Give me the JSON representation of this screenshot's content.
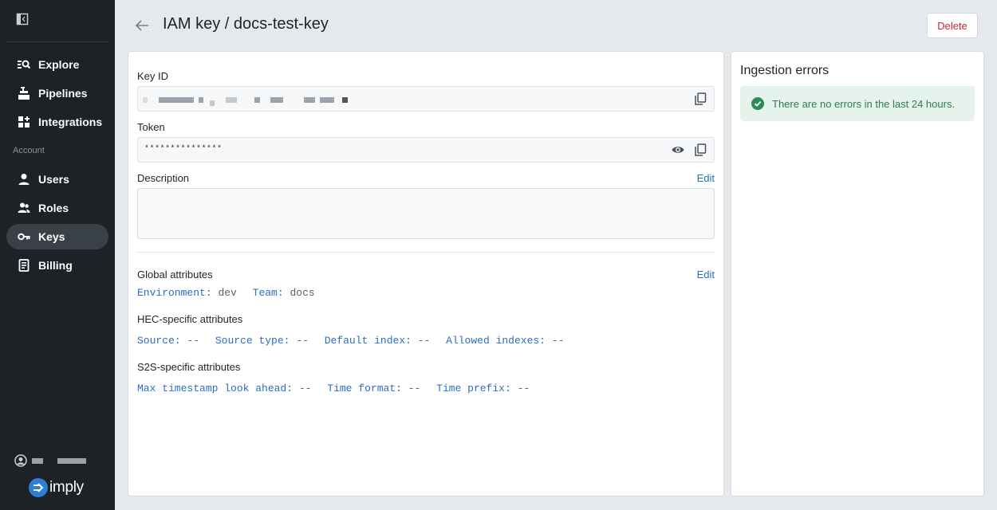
{
  "sidebar": {
    "nav": [
      {
        "label": "Explore",
        "icon": "explore-icon"
      },
      {
        "label": "Pipelines",
        "icon": "pipelines-icon"
      },
      {
        "label": "Integrations",
        "icon": "integrations-icon"
      }
    ],
    "section_label": "Account",
    "account_nav": [
      {
        "label": "Users",
        "icon": "user-icon"
      },
      {
        "label": "Roles",
        "icon": "roles-icon"
      },
      {
        "label": "Keys",
        "icon": "key-icon",
        "active": true
      },
      {
        "label": "Billing",
        "icon": "billing-icon"
      }
    ],
    "logo_text": "imply"
  },
  "header": {
    "title": "IAM key / docs-test-key",
    "delete_label": "Delete"
  },
  "key_details": {
    "key_id_label": "Key ID",
    "token_label": "Token",
    "token_value": "***************",
    "description_label": "Description",
    "description_edit": "Edit",
    "global_attributes_label": "Global attributes",
    "global_edit": "Edit",
    "global_attributes": [
      {
        "key": "Environment:",
        "value": "dev"
      },
      {
        "key": "Team:",
        "value": "docs"
      }
    ],
    "hec_label": "HEC-specific attributes",
    "hec_attributes": [
      {
        "key": "Source:",
        "value": "--"
      },
      {
        "key": "Source type:",
        "value": "--"
      },
      {
        "key": "Default index:",
        "value": "--"
      },
      {
        "key": "Allowed indexes:",
        "value": "--"
      }
    ],
    "s2s_label": "S2S-specific attributes",
    "s2s_attributes": [
      {
        "key": "Max timestamp look ahead:",
        "value": "--"
      },
      {
        "key": "Time format:",
        "value": "--"
      },
      {
        "key": "Time prefix:",
        "value": "--"
      }
    ]
  },
  "ingestion": {
    "title": "Ingestion errors",
    "message": "There are no errors in the last 24 hours."
  },
  "colors": {
    "sidebar_bg": "#1e2227",
    "accent": "#2a6dc4",
    "danger": "#c8262e",
    "success": "#2e7a52"
  }
}
